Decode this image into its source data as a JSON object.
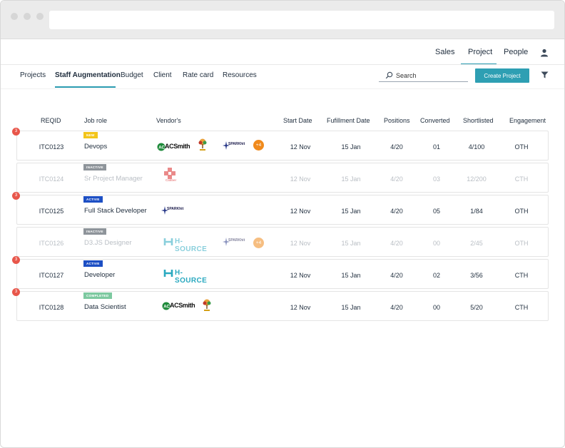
{
  "nav": {
    "top": [
      "Sales",
      "Project",
      "People"
    ],
    "top_active": "Project",
    "sub": [
      "Projects",
      "Staff Augmentation",
      "Budget",
      "Client",
      "Rate card",
      "Resources"
    ],
    "sub_active": "Staff Augmentation"
  },
  "search": {
    "placeholder": "Search"
  },
  "create_button": "Create Project",
  "columns": [
    "REQID",
    "Job role",
    "Vendor's",
    "Start Date",
    "Fufillment Date",
    "Positions",
    "Converted",
    "Shortlisted",
    "Engagement"
  ],
  "rows": [
    {
      "notif": "3",
      "reqid": "ITC0123",
      "status": "NEW",
      "role": "Devops",
      "start": "12 Nov",
      "fulfill": "15 Jan",
      "positions": "4/20",
      "converted": "01",
      "shortlisted": "4/100",
      "engagement": "OTH",
      "vendors_more": "+4"
    },
    {
      "notif": "",
      "reqid": "ITC0124",
      "status": "INACTIVE",
      "role": "Sr Project Manager",
      "start": "12 Nov",
      "fulfill": "15 Jan",
      "positions": "4/20",
      "converted": "03",
      "shortlisted": "12/200",
      "engagement": "CTH",
      "vendors_more": ""
    },
    {
      "notif": "3",
      "reqid": "ITC0125",
      "status": "ACTIVE",
      "role": "Full Stack Developer",
      "start": "12 Nov",
      "fulfill": "15 Jan",
      "positions": "4/20",
      "converted": "05",
      "shortlisted": "1/84",
      "engagement": "OTH",
      "vendors_more": ""
    },
    {
      "notif": "",
      "reqid": "ITC0126",
      "status": "INACTIVE",
      "role": "D3.JS Designer",
      "start": "12 Nov",
      "fulfill": "15 Jan",
      "positions": "4/20",
      "converted": "00",
      "shortlisted": "2/45",
      "engagement": "OTH",
      "vendors_more": "+4"
    },
    {
      "notif": "3",
      "reqid": "ITC0127",
      "status": "ACTIVE",
      "role": "Developer",
      "start": "12 Nov",
      "fulfill": "15 Jan",
      "positions": "4/20",
      "converted": "02",
      "shortlisted": "3/56",
      "engagement": "CTH",
      "vendors_more": ""
    },
    {
      "notif": "3",
      "reqid": "ITC0128",
      "status": "COMPLETED",
      "role": "Data Scientist",
      "start": "12 Nov",
      "fulfill": "15 Jan",
      "positions": "4/20",
      "converted": "00",
      "shortlisted": "5/20",
      "engagement": "CTH",
      "vendors_more": ""
    }
  ],
  "vendor_logos": {
    "acsmith": "ACSmith",
    "hsource": "H-SOURCE",
    "spark": "SPARKhit",
    "caliber": "Caliber"
  },
  "colors": {
    "accent": "#2e9fb3",
    "notif": "#e8564a",
    "more": "#f08a1c",
    "new": "#f3c51a",
    "inactive": "#8e949a",
    "active": "#1d4fc4",
    "completed": "#7dc9a0"
  }
}
